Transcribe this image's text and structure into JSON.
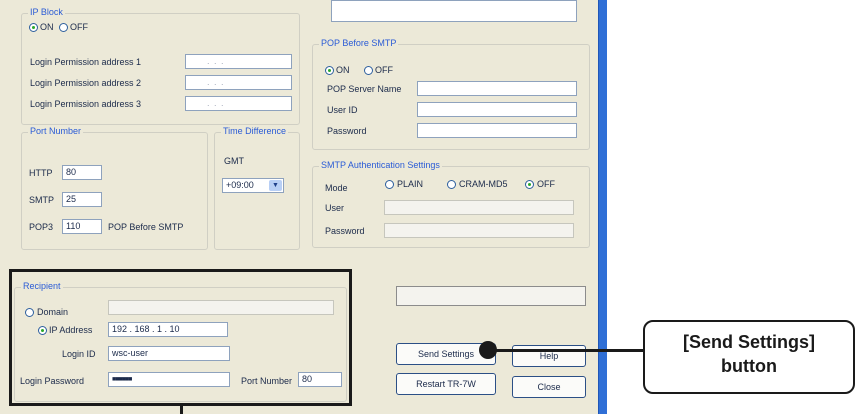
{
  "ip_block": {
    "title": "IP Block",
    "on_label": "ON",
    "off_label": "OFF",
    "addr1_label": "Login Permission address 1",
    "addr2_label": "Login Permission address 2",
    "addr3_label": "Login Permission address 3",
    "addr_placeholder": ". . ."
  },
  "port_number": {
    "title": "Port Number",
    "http_label": "HTTP",
    "http_value": "80",
    "smtp_label": "SMTP",
    "smtp_value": "25",
    "pop3_label": "POP3",
    "pop3_value": "110",
    "pop3_note": "POP Before SMTP"
  },
  "time_difference": {
    "title": "Time Difference",
    "gmt_label": "GMT",
    "value": "+09:00"
  },
  "pop_before_smtp": {
    "title": "POP Before SMTP",
    "on_label": "ON",
    "off_label": "OFF",
    "server_label": "POP Server Name",
    "user_label": "User ID",
    "password_label": "Password"
  },
  "smtp_auth": {
    "title": "SMTP Authentication Settings",
    "mode_label": "Mode",
    "plain_label": "PLAIN",
    "crammd5_label": "CRAM-MD5",
    "off_label": "OFF",
    "user_label": "User",
    "password_label": "Password"
  },
  "recipient": {
    "title": "Recipient",
    "domain_label": "Domain",
    "ip_label": "IP Address",
    "ip_value": "192 . 168 . 1 . 10",
    "login_id_label": "Login ID",
    "login_id_value": "wsc-user",
    "login_password_label": "Login Password",
    "login_password_value": "■■■■■■",
    "port_label": "Port Number",
    "port_value": "80"
  },
  "buttons": {
    "send_settings": "Send Settings",
    "help": "Help",
    "restart": "Restart TR-7W",
    "close": "Close"
  },
  "annotation": {
    "line1": "[Send Settings]",
    "line2": "button"
  }
}
